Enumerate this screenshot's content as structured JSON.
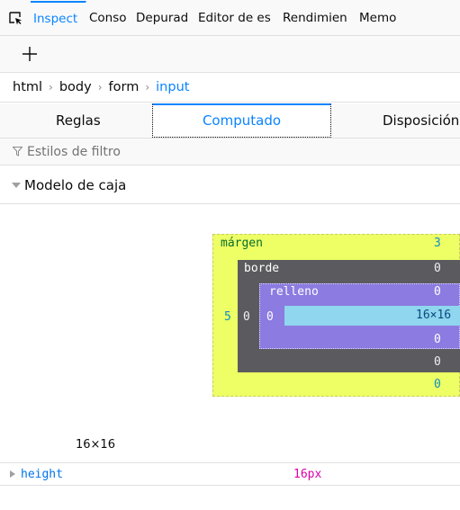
{
  "tool_tabs": [
    {
      "label": "Inspect",
      "selected": true
    },
    {
      "label": "Conso",
      "selected": false
    },
    {
      "label": "Depurad",
      "selected": false
    },
    {
      "label": "Editor de es",
      "selected": false
    },
    {
      "label": "Rendimien",
      "selected": false
    },
    {
      "label": "Memo",
      "selected": false
    }
  ],
  "breadcrumb": [
    "html",
    "body",
    "form",
    "input"
  ],
  "sidebar_tabs": {
    "rules": "Reglas",
    "computed": "Computado",
    "layout": "Disposición"
  },
  "filter": {
    "placeholder": "Estilos de filtro"
  },
  "section": {
    "title": "Modelo de caja"
  },
  "box_model": {
    "margin_label": "márgen",
    "margin_top": "3",
    "margin_left": "5",
    "margin_bottom": "0",
    "border_label": "borde",
    "border_top": "0",
    "border_left": "0",
    "border_bottom": "0",
    "padding_label": "relleno",
    "padding_top": "0",
    "padding_left": "0",
    "padding_bottom": "0",
    "content_size": "16×16",
    "size_readout": "16×16"
  },
  "properties": [
    {
      "name": "height",
      "value": "16px"
    }
  ],
  "colors": {
    "accent": "#0a84ff",
    "margin": "#edff64",
    "border": "#5b5b5f",
    "padding": "#8c7be0",
    "content": "#8fd6ee",
    "property_value": "#dd00a9"
  }
}
